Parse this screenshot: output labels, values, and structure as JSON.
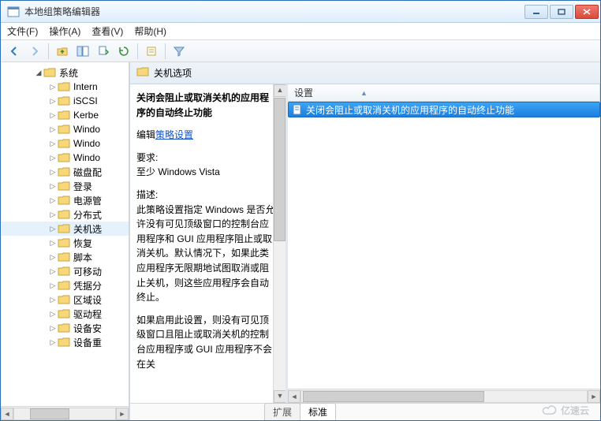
{
  "window": {
    "title": "本地组策略编辑器"
  },
  "menu": {
    "file": "文件(F)",
    "action": "操作(A)",
    "view": "查看(V)",
    "help": "帮助(H)"
  },
  "tree": {
    "root": "系统",
    "items": [
      "Intern",
      "iSCSI",
      "Kerbe",
      "Windo",
      "Windo",
      "Windo",
      "磁盘配",
      "登录",
      "电源管",
      "分布式",
      "关机选",
      "恢复",
      "脚本",
      "可移动",
      "凭据分",
      "区域设",
      "驱动程",
      "设备安",
      "设备重"
    ],
    "selected_index": 10
  },
  "header": {
    "title": "关机选项"
  },
  "description": {
    "title": "关闭会阻止或取消关机的应用程序的自动终止功能",
    "edit_prefix": "编辑",
    "edit_link": "策略设置",
    "req_label": "要求:",
    "req_value": "至少 Windows Vista",
    "desc_label": "描述:",
    "desc_p1": "此策略设置指定 Windows 是否允许没有可见顶级窗口的控制台应用程序和 GUI 应用程序阻止或取消关机。默认情况下，如果此类应用程序无限期地试图取消或阻止关机，则这些应用程序会自动终止。",
    "desc_p2": "如果启用此设置，则没有可见顶级窗口且阻止或取消关机的控制台应用程序或 GUI 应用程序不会在关"
  },
  "list": {
    "column": "设置",
    "rows": [
      {
        "label": "关闭会阻止或取消关机的应用程序的自动终止功能",
        "selected": true
      }
    ]
  },
  "tabs": {
    "extended": "扩展",
    "standard": "标准"
  },
  "watermark": "亿速云"
}
